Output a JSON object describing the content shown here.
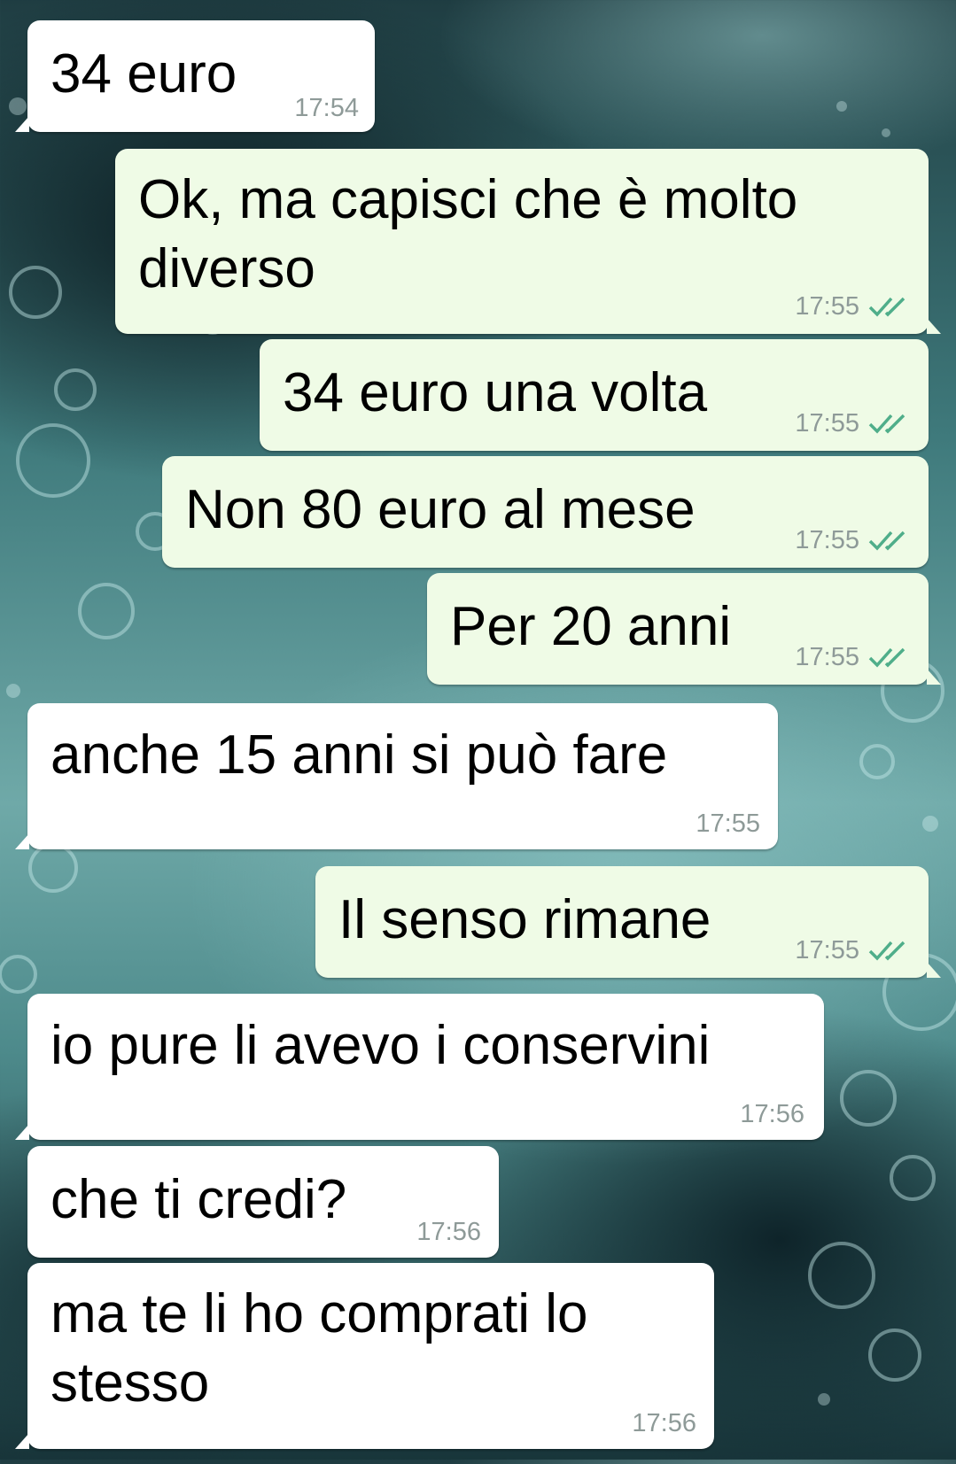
{
  "chat": {
    "messages": [
      {
        "direction": "incoming",
        "text": "34 euro",
        "time": "17:54"
      },
      {
        "direction": "outgoing",
        "text": "Ok, ma capisci che è molto diverso",
        "time": "17:55",
        "status": "read"
      },
      {
        "direction": "outgoing",
        "text": "34 euro una volta",
        "time": "17:55",
        "status": "read"
      },
      {
        "direction": "outgoing",
        "text": "Non 80 euro al mese",
        "time": "17:55",
        "status": "read"
      },
      {
        "direction": "outgoing",
        "text": "Per 20 anni",
        "time": "17:55",
        "status": "read"
      },
      {
        "direction": "incoming",
        "text": "anche 15 anni si può fare",
        "time": "17:55"
      },
      {
        "direction": "outgoing",
        "text": "Il senso rimane",
        "time": "17:55",
        "status": "read"
      },
      {
        "direction": "incoming",
        "text": "io pure li avevo i conservini",
        "time": "17:56"
      },
      {
        "direction": "incoming",
        "text": "che ti credi?",
        "time": "17:56"
      },
      {
        "direction": "incoming",
        "text": "ma te li ho comprati lo stesso",
        "time": "17:56"
      }
    ]
  },
  "colors": {
    "incoming_bubble": "#ffffff",
    "outgoing_bubble": "#effbe6",
    "timestamp": "#8e9a98",
    "read_ticks": "#4fae8a"
  },
  "icons": {
    "read_status": "double-check-icon"
  }
}
